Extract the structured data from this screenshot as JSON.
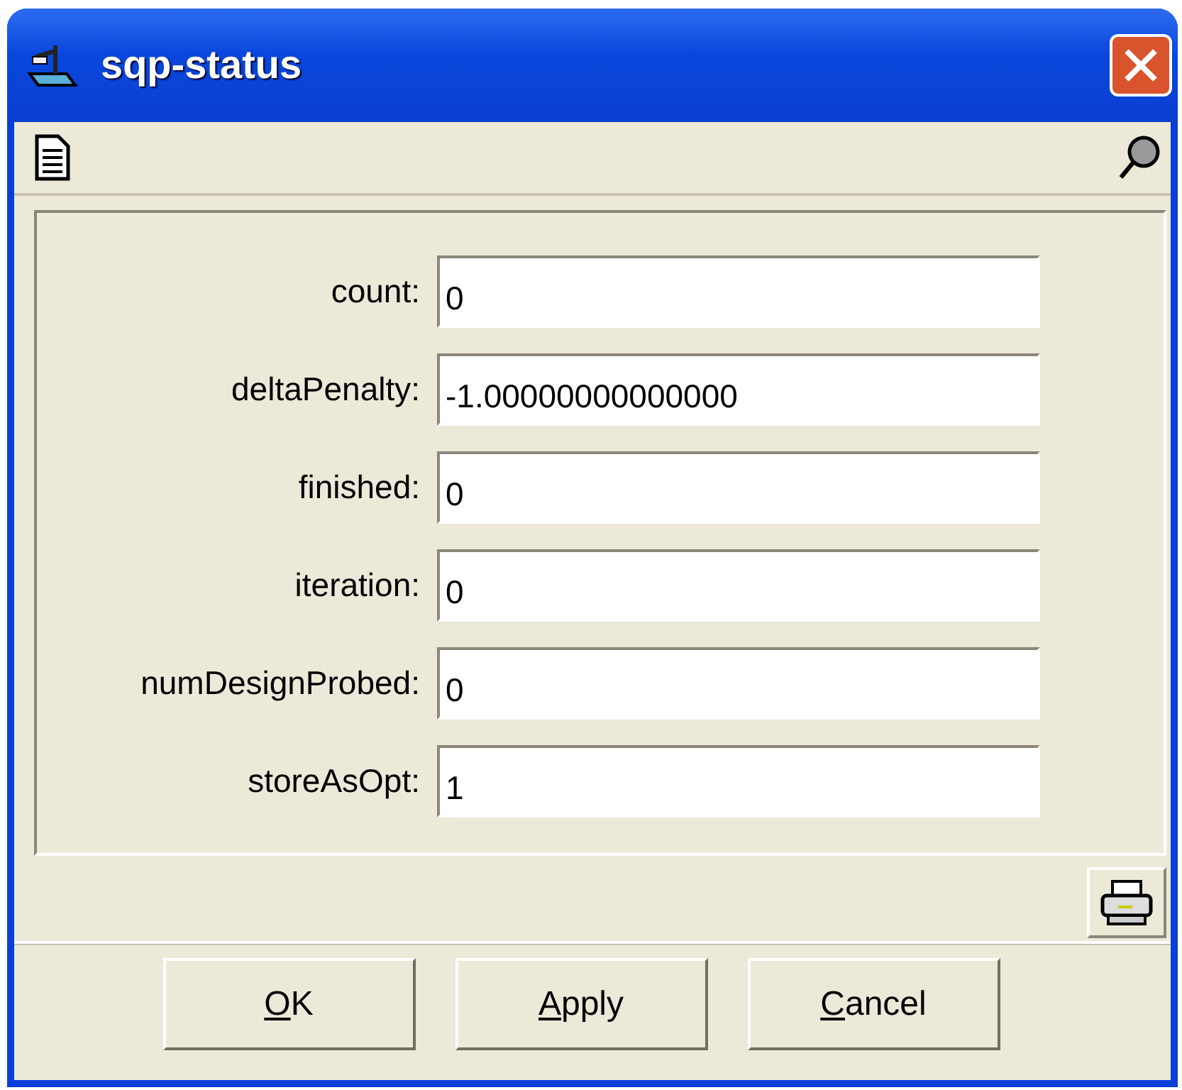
{
  "window": {
    "title": "sqp-status"
  },
  "fields": [
    {
      "label": "count:",
      "value": "0"
    },
    {
      "label": "deltaPenalty:",
      "value": "-1.00000000000000"
    },
    {
      "label": "finished:",
      "value": "0"
    },
    {
      "label": "iteration:",
      "value": "0"
    },
    {
      "label": "numDesignProbed:",
      "value": "0"
    },
    {
      "label": "storeAsOpt:",
      "value": "1"
    }
  ],
  "buttons": [
    {
      "mnemonic": "O",
      "rest": "K"
    },
    {
      "mnemonic": "A",
      "rest": "pply"
    },
    {
      "mnemonic": "C",
      "rest": "ancel"
    }
  ]
}
